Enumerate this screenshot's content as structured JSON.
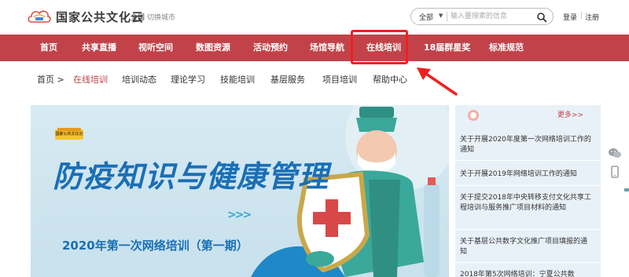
{
  "header": {
    "logo_text": "国家公共文化云",
    "region": "全国",
    "switch_city": "切换城市",
    "search": {
      "scope": "全部",
      "placeholder": "输入要搜索的信息"
    },
    "login": "登录",
    "separator": "|",
    "register": "注册"
  },
  "nav": {
    "items": [
      {
        "label": "首页"
      },
      {
        "label": "共享直播"
      },
      {
        "label": "视听空间"
      },
      {
        "label": "数图资源"
      },
      {
        "label": "活动预约"
      },
      {
        "label": "场馆导航"
      },
      {
        "label": "在线培训"
      },
      {
        "label": "18届群星奖"
      },
      {
        "label": "标准规范"
      }
    ],
    "active": "在线培训",
    "background_color": "#c14349"
  },
  "subnav": {
    "home": "首页 >",
    "items": [
      {
        "label": "在线培训"
      },
      {
        "label": "培训动态"
      },
      {
        "label": "理论学习"
      },
      {
        "label": "技能培训"
      },
      {
        "label": "基层服务"
      },
      {
        "label": "项目培训"
      },
      {
        "label": "帮助中心"
      }
    ],
    "active": "在线培训"
  },
  "banner": {
    "badge": "国家公共文化云",
    "title": "防疫知识与健康管理",
    "subtitle": "2020年第一次网络培训（第一期）"
  },
  "news": {
    "more": "更多>>",
    "items": [
      {
        "title": "关于开展2020年度第一次网络培训工作的通知"
      },
      {
        "title": "关于开展2019年网络培训工作的通知"
      },
      {
        "title": "关于提交2018年中央转移支付文化共享工程培训与服务推广项目材料的通知"
      },
      {
        "title": "关于基层公共数字文化推广项目填报的通知"
      },
      {
        "title": "2018年第5次网络培训：宁夏公共数"
      }
    ]
  },
  "colors": {
    "accent": "#c14349",
    "highlight_box": "#ee2020",
    "banner_text": "#1a6fb5"
  }
}
